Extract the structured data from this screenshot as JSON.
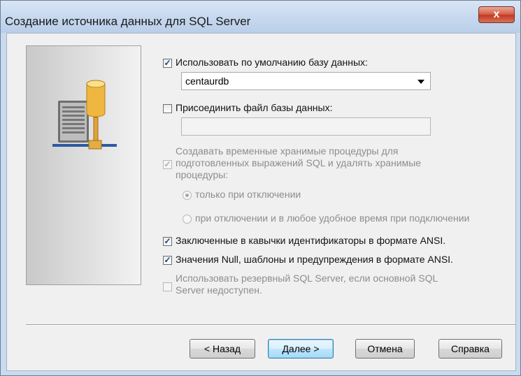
{
  "window": {
    "title": "Создание источника данных для SQL Server",
    "close_symbol": "x"
  },
  "form": {
    "use_default_db": {
      "label": "Использовать по умолчанию базу данных:",
      "checked": true
    },
    "default_db_value": "centaurdb",
    "attach_file": {
      "label": "Присоединить файл  базы данных:",
      "checked": false
    },
    "attach_file_value": "",
    "temp_procs": {
      "line1": "Создавать временные хранимые процедуры для",
      "line2": "подготовленных выражений SQL и удалять хранимые",
      "line3": "процедуры:",
      "checked": true,
      "enabled": false
    },
    "radio_on_disconnect": {
      "label": "только при отключении",
      "selected": true
    },
    "radio_on_disconnect_and_anytime": {
      "label": "при отключении и в любое удобное время при подключении",
      "selected": false
    },
    "ansi_quoted": {
      "label": "Заключенные в кавычки идентификаторы в формате ANSI.",
      "checked": true
    },
    "ansi_nulls": {
      "label": "Значения Null, шаблоны и предупреждения в формате ANSI.",
      "checked": true
    },
    "failover": {
      "line1": "Использовать резервный SQL Server, если основной SQL",
      "line2": "Server недоступен.",
      "checked": false,
      "enabled": false
    }
  },
  "buttons": {
    "back": "< Назад",
    "next": "Далее >",
    "cancel": "Отмена",
    "help": "Справка"
  },
  "icons": {
    "check": "✓",
    "server_graphic": "database-server-icon"
  }
}
